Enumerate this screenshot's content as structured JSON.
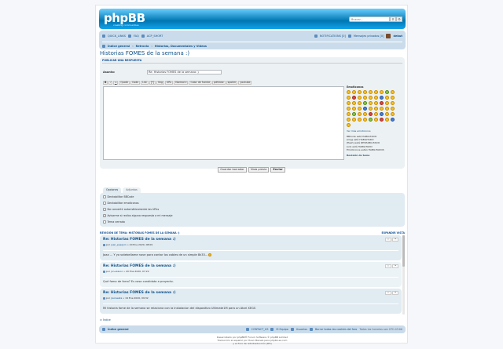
{
  "header": {
    "logo": "phpBB",
    "tagline": "creating communities",
    "search_placeholder": "Buscar…"
  },
  "nav": {
    "quick_links": "QUICK_LINKS",
    "faq": "FAQ",
    "acp_short": "ACP_SHORT",
    "notifications": "NOTIFICATIONS [0]",
    "private_messages": "Mensajes privados [0]",
    "user": "debut",
    "breadcrumb": [
      "Índice general",
      "Retrovia",
      "Historias, Documentales y Videos"
    ]
  },
  "page_title": "Historias FOMES de la semana :)",
  "post_form": {
    "heading": "PUBLICAR UNA RESPUESTA",
    "subject_label": "Asunto:",
    "subject_value": "Re: Historias FOMES de la semana :)",
    "toolbar": [
      "B",
      "i",
      "u",
      "Quote",
      "Code",
      "List",
      "[*]",
      "Img",
      "URL",
      "Normal",
      "Color de fuente",
      "pdfview",
      "spoiler",
      "youtube"
    ],
    "smileys_title": "Emoticonos",
    "more_smileys": "Ver más emoticonos",
    "options_status": [
      "BBCode está HABILITADO",
      "[img] está HABILITADO",
      "[flash] está DESHABILITADO",
      "[url] está HABILITADO",
      "Emoticonos están HABILITADOS"
    ],
    "review_link": "Revisión de tema"
  },
  "actions": {
    "save": "Guardar borrador",
    "preview": "Vista previa",
    "submit": "Enviar"
  },
  "tabs": [
    "Opciones",
    "Adjuntos"
  ],
  "options": [
    {
      "label": "Deshabilitar BBCode",
      "checked": false
    },
    {
      "label": "Deshabilitar emoticonos",
      "checked": false
    },
    {
      "label": "No convertir automáticamente las URLs",
      "checked": false
    },
    {
      "label": "Avisarme si recibo alguna respuesta a mi mensaje",
      "checked": true
    },
    {
      "label": "Tema cerrado",
      "checked": false
    }
  ],
  "review": {
    "heading": "REVISIÓN DE TEMA: HISTORIAS FOMES DE LA SEMANA :)",
    "expand": "EXPANDIR VISTA",
    "posts": [
      {
        "title": "Re: Historias FOMES de la semana :)",
        "author": "juan_pasquin",
        "date": "20 Ene 2020, 08:09",
        "body": "Jaaa ... Y yo votebeliame nove para cantar los cables de un simple 8k33... "
      },
      {
        "title": "Re: Historias FOMES de la semana :)",
        "author": "jon-elasco",
        "date": "20 Ene 2020, 07:22",
        "body": "Qué fomo de forro? Es caso candidata a proyecto."
      },
      {
        "title": "Re: Historias FOMES de la semana :)",
        "author": "jrecisesta",
        "date": "19 Ene 2020, 09:32",
        "body": "Mi historia fome de la semana se relaciona con la instalacion del dispositivo Ultimate1M para un Atari XEGS"
      }
    ]
  },
  "jump_label": "Índice",
  "footer": {
    "index": "Índice general",
    "contact": "CONTACT_US",
    "team": "El Equipo",
    "members": "Usuarios",
    "delete_cookies": "Borrar todas las cookies del foro",
    "timezone": "Todos los horarios son UTC-03:00",
    "credits": [
      "Desarrollado por phpBB® Forum Software © phpBB Limited",
      "Traducción al español por Huan Manwë para phpbb-es.com",
      "y el Foro de retrotraducción (RTI)"
    ]
  }
}
